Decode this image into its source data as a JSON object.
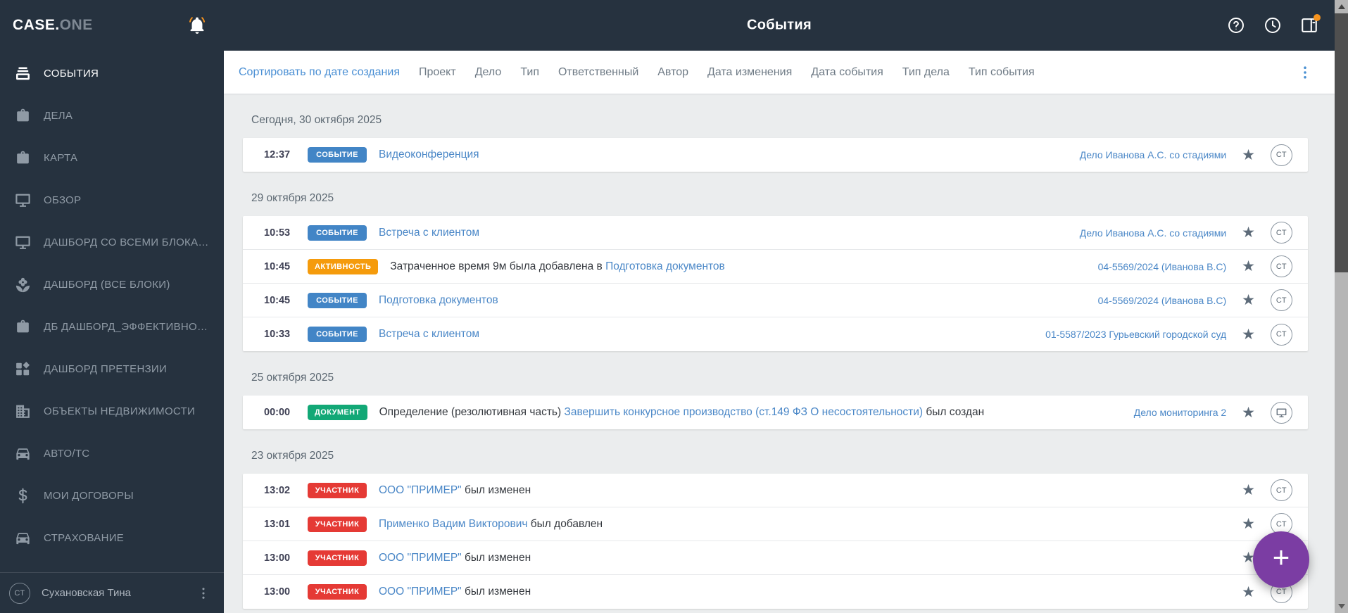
{
  "brand": {
    "primary": "CASE.",
    "secondary": "ONE"
  },
  "header": {
    "title": "События"
  },
  "sidebar": {
    "items": [
      {
        "id": "events",
        "label": "СОБЫТИЯ",
        "icon": "events-icon",
        "active": true
      },
      {
        "id": "cases",
        "label": "ДЕЛА",
        "icon": "briefcase-icon",
        "active": false
      },
      {
        "id": "map",
        "label": "КАРТА",
        "icon": "briefcase-icon",
        "active": false
      },
      {
        "id": "overview",
        "label": "ОБЗОР",
        "icon": "monitor-icon",
        "active": false
      },
      {
        "id": "dashboard-all-blocks",
        "label": "ДАШБОРД СО ВСЕМИ БЛОКА…",
        "icon": "monitor-icon",
        "active": false
      },
      {
        "id": "dashboard-vse-bloki",
        "label": "ДАШБОРД (ВСЕ БЛОКИ)",
        "icon": "flower-icon",
        "active": false
      },
      {
        "id": "db-dashboard-effective",
        "label": "ДБ ДАШБОРД_ЭФФЕКТИВНО…",
        "icon": "briefcase-icon",
        "active": false
      },
      {
        "id": "dashboard-pretenzii",
        "label": "ДАШБОРД ПРЕТЕНЗИИ",
        "icon": "dashboard-icon",
        "active": false
      },
      {
        "id": "real-estate",
        "label": "ОБЪЕКТЫ НЕДВИЖИМОСТИ",
        "icon": "building-icon",
        "active": false
      },
      {
        "id": "auto-ts",
        "label": "АВТО/ТС",
        "icon": "car-icon",
        "active": false
      },
      {
        "id": "my-contracts",
        "label": "МОИ ДОГОВОРЫ",
        "icon": "dollar-icon",
        "active": false
      },
      {
        "id": "insurance",
        "label": "СТРАХОВАНИЕ",
        "icon": "car-icon",
        "active": false
      }
    ],
    "user": {
      "initials": "СТ",
      "name": "Сухановская Тина"
    }
  },
  "filter_bar": {
    "sort_label": "Сортировать по дате создания",
    "filters": [
      "Проект",
      "Дело",
      "Тип",
      "Ответственный",
      "Автор",
      "Дата изменения",
      "Дата события",
      "Тип дела",
      "Тип события"
    ]
  },
  "badge_colors": {
    "СОБЫТИЕ": "#4285c6",
    "АКТИВНОСТЬ": "#f59b0c",
    "ДОКУМЕНТ": "#12a876",
    "УЧАСТНИК": "#e53a35"
  },
  "groups": [
    {
      "date": "Сегодня, 30 октября 2025",
      "events": [
        {
          "time": "12:37",
          "badge": "СОБЫТИЕ",
          "parts": [
            {
              "text": "Видеоконференция",
              "link": true
            }
          ],
          "case_link": "Дело Иванова А.С. со стадиями",
          "avatar": "СТ"
        }
      ]
    },
    {
      "date": "29 октября 2025",
      "events": [
        {
          "time": "10:53",
          "badge": "СОБЫТИЕ",
          "parts": [
            {
              "text": "Встреча с клиентом",
              "link": true
            }
          ],
          "case_link": "Дело Иванова А.С. со стадиями",
          "avatar": "СТ"
        },
        {
          "time": "10:45",
          "badge": "АКТИВНОСТЬ",
          "parts": [
            {
              "text": "Затраченное время 9м была добавлена в ",
              "link": false
            },
            {
              "text": "Подготовка документов",
              "link": true
            }
          ],
          "case_link": "04-5569/2024 (Иванова В.С)",
          "avatar": "СТ"
        },
        {
          "time": "10:45",
          "badge": "СОБЫТИЕ",
          "parts": [
            {
              "text": "Подготовка документов",
              "link": true
            }
          ],
          "case_link": "04-5569/2024 (Иванова В.С)",
          "avatar": "СТ"
        },
        {
          "time": "10:33",
          "badge": "СОБЫТИЕ",
          "parts": [
            {
              "text": "Встреча с клиентом",
              "link": true
            }
          ],
          "case_link": "01-5587/2023 Гурьевский городской суд",
          "avatar": "СТ"
        }
      ]
    },
    {
      "date": "25 октября 2025",
      "events": [
        {
          "time": "00:00",
          "badge": "ДОКУМЕНТ",
          "parts": [
            {
              "text": "Определение (резолютивная часть) ",
              "link": false
            },
            {
              "text": "Завершить конкурсное производство (ст.149 ФЗ О несостоятельности)",
              "link": true
            },
            {
              "text": " был создан",
              "link": false
            }
          ],
          "case_link": "Дело мониторинга 2",
          "avatar": "monitor"
        }
      ]
    },
    {
      "date": "23 октября 2025",
      "events": [
        {
          "time": "13:02",
          "badge": "УЧАСТНИК",
          "parts": [
            {
              "text": "ООО \"ПРИМЕР\"",
              "link": true
            },
            {
              "text": " был изменен",
              "link": false
            }
          ],
          "case_link": "",
          "avatar": "СТ"
        },
        {
          "time": "13:01",
          "badge": "УЧАСТНИК",
          "parts": [
            {
              "text": "Применко Вадим Викторович",
              "link": true
            },
            {
              "text": " был добавлен",
              "link": false
            }
          ],
          "case_link": "",
          "avatar": "СТ"
        },
        {
          "time": "13:00",
          "badge": "УЧАСТНИК",
          "parts": [
            {
              "text": "ООО \"ПРИМЕР\"",
              "link": true
            },
            {
              "text": " был изменен",
              "link": false
            }
          ],
          "case_link": "",
          "avatar": "СТ"
        },
        {
          "time": "13:00",
          "badge": "УЧАСТНИК",
          "parts": [
            {
              "text": "ООО \"ПРИМЕР\"",
              "link": true
            },
            {
              "text": " был изменен",
              "link": false
            }
          ],
          "case_link": "",
          "avatar": "СТ"
        }
      ]
    }
  ],
  "fab": {
    "label": "+",
    "color": "#7b3da3"
  },
  "colors": {
    "sidebar_bg": "#26323f",
    "link_blue": "#4a87c7",
    "sort_blue": "#4a8fd4",
    "orange_dot": "#f7941e",
    "content_bg": "#ebedee"
  }
}
